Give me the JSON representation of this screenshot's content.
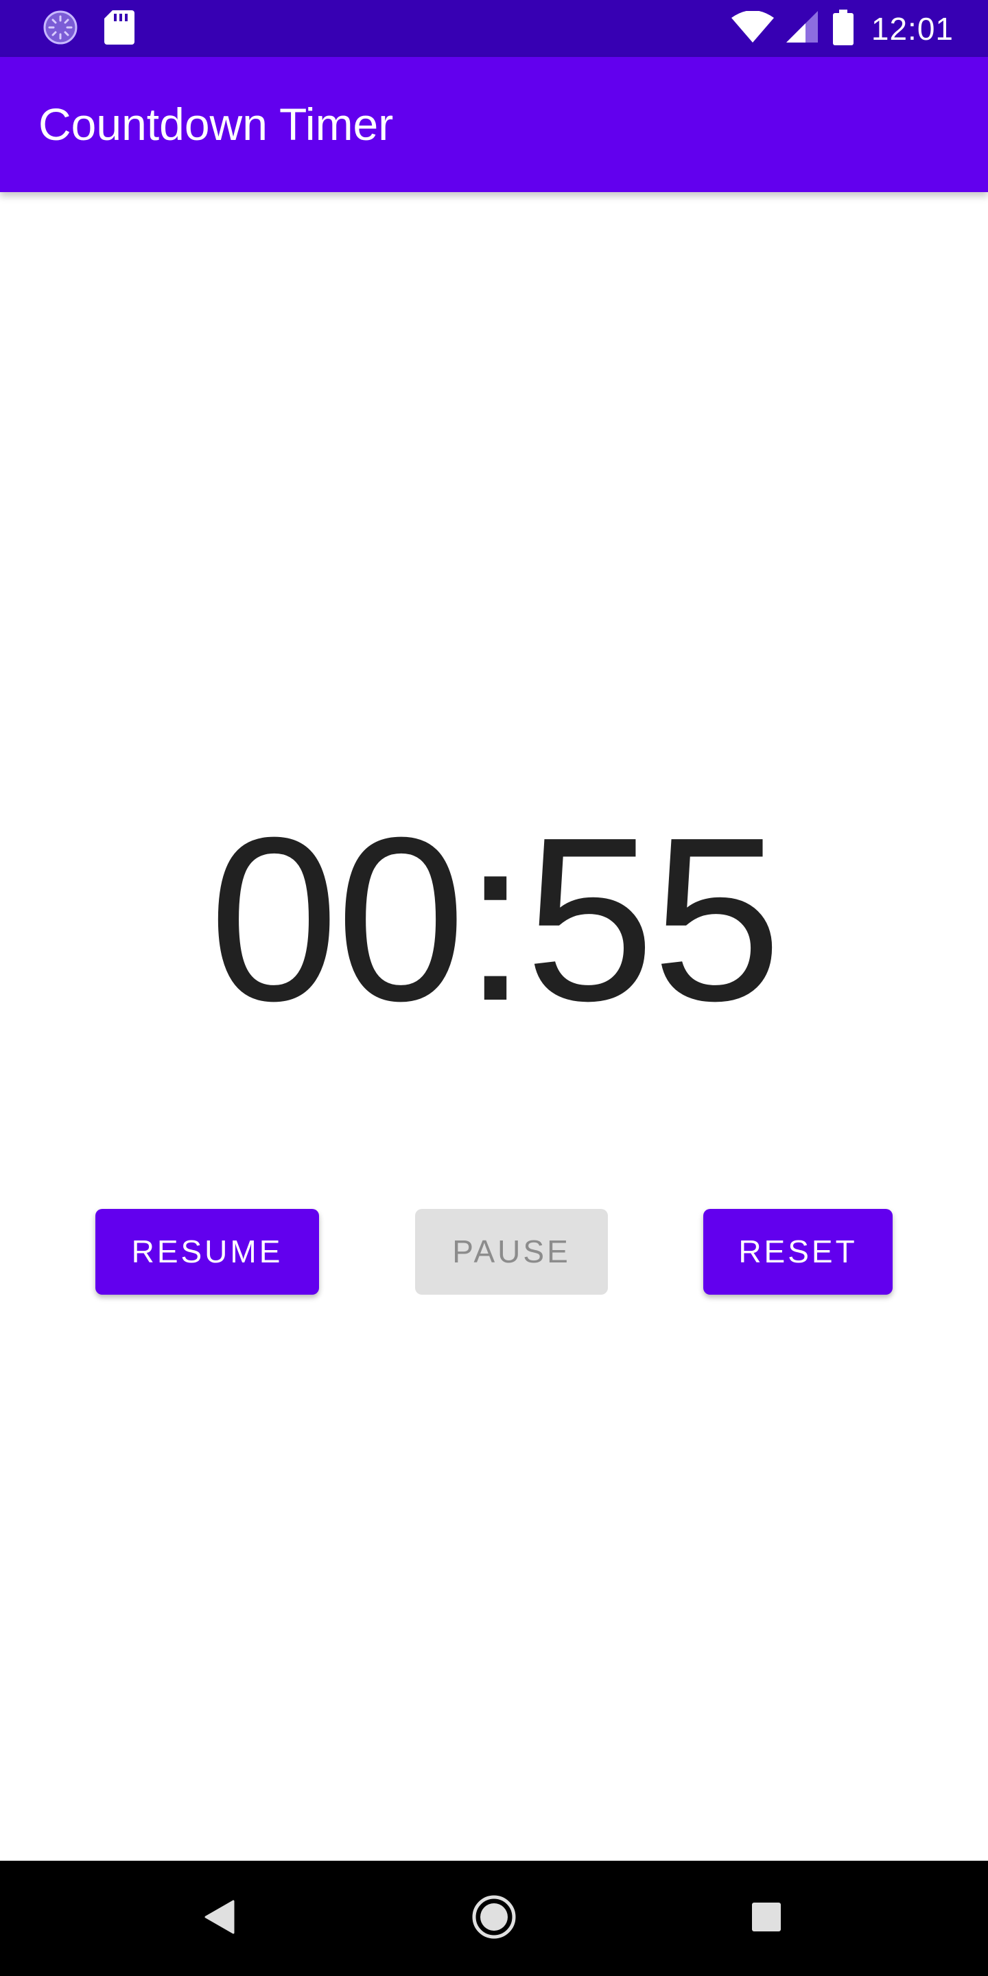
{
  "status_bar": {
    "time": "12:01",
    "icons": [
      "sync-icon",
      "sd-card-icon",
      "wifi-icon",
      "cell-signal-icon",
      "battery-icon"
    ]
  },
  "app_bar": {
    "title": "Countdown Timer"
  },
  "timer": {
    "display": "00:55"
  },
  "buttons": {
    "resume_label": "RESUME",
    "pause_label": "PAUSE",
    "reset_label": "RESET",
    "pause_enabled": false
  },
  "nav_bar": {
    "icons": [
      "back-icon",
      "home-icon",
      "recents-icon"
    ]
  },
  "colors": {
    "status_bar": "#3700B3",
    "primary": "#6200EE",
    "timer_text": "#212121",
    "disabled_button": "#E0E0E0",
    "disabled_text": "#8C8C8C",
    "nav_bar": "#000000"
  }
}
